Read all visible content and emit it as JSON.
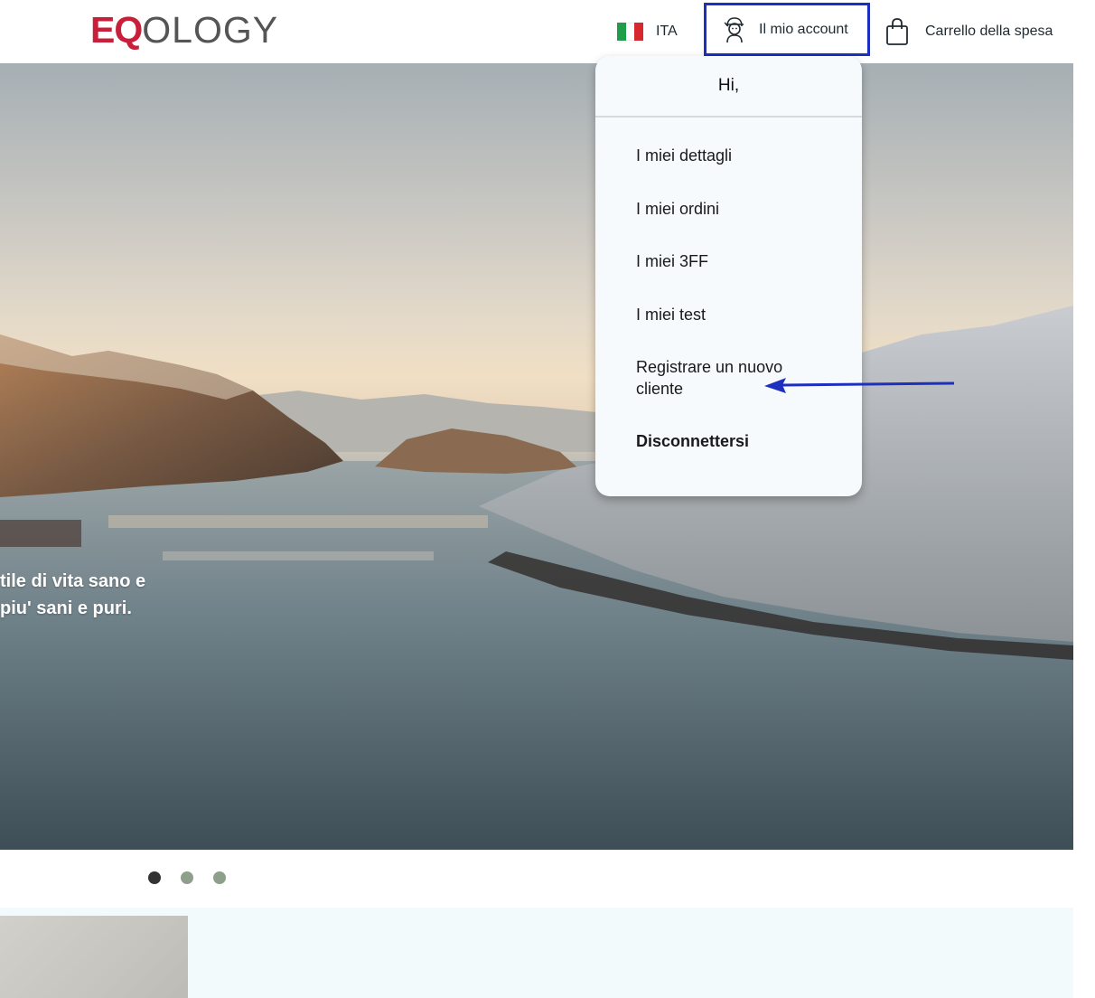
{
  "header": {
    "logo": {
      "eq": "EQ",
      "ology": "OLOGY"
    },
    "language": {
      "flag_colors": [
        "#1f9d4b",
        "#ffffff",
        "#d6282f"
      ],
      "label": "ITA",
      "flag_icon": "italy-flag-icon"
    },
    "account": {
      "label": "Il mio account",
      "icon": "user-avatar-icon"
    },
    "cart": {
      "label": "Carrello della spesa",
      "icon": "shopping-bag-icon"
    }
  },
  "account_menu": {
    "greeting": "Hi,",
    "items": [
      {
        "label": "I miei dettagli"
      },
      {
        "label": "I miei ordini"
      },
      {
        "label": "I miei 3FF"
      },
      {
        "label": "I miei test"
      },
      {
        "label": "Registrare un nuovo cliente"
      },
      {
        "label": "Disconnettersi"
      }
    ]
  },
  "hero": {
    "text_line1": "tile di vita sano e",
    "text_line2": " piu' sani e puri."
  },
  "carousel": {
    "slide_count": 3,
    "active_index": 0
  },
  "colors": {
    "brand_red": "#c8203a",
    "highlight_box": "#1c2fbf",
    "annotation_arrow": "#1c2fbf",
    "dot_active": "#333333",
    "dot_inactive": "#8ea08c"
  }
}
